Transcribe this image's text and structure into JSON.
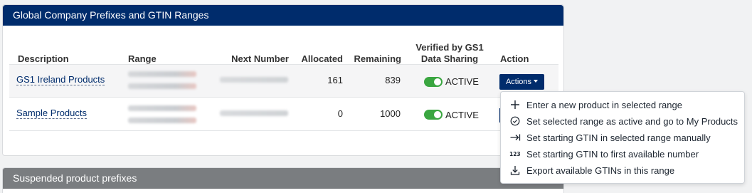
{
  "prefixes_card": {
    "title": "Global Company Prefixes and GTIN Ranges",
    "columns": {
      "description": "Description",
      "range": "Range",
      "next_number": "Next Number",
      "allocated": "Allocated",
      "remaining": "Remaining",
      "verified_line1": "Verified by GS1",
      "verified_line2": "Data Sharing",
      "action": "Action"
    },
    "rows": [
      {
        "description": "GS1 Ireland Products",
        "allocated": "161",
        "remaining": "839",
        "status": "ACTIVE"
      },
      {
        "description": "Sample Products",
        "allocated": "0",
        "remaining": "1000",
        "status": "ACTIVE"
      }
    ],
    "actions_label": "Actions"
  },
  "actions_menu": {
    "items": [
      {
        "label": "Enter a new product in selected range",
        "icon": "plus-icon"
      },
      {
        "label": "Set selected range as active and go to My Products",
        "icon": "check-circle-icon"
      },
      {
        "label": "Set starting GTIN in selected range manually",
        "icon": "arrow-to-bar-icon"
      },
      {
        "label": "Set starting GTIN to first available number",
        "icon": "numbers-123-icon"
      },
      {
        "label": "Export available GTINs in this range",
        "icon": "download-icon"
      }
    ]
  },
  "suspended_card": {
    "title": "Suspended product prefixes"
  },
  "colors": {
    "header_navy": "#002c6c",
    "toggle_green": "#3aa640",
    "suspended_grey": "#7a7d80"
  }
}
